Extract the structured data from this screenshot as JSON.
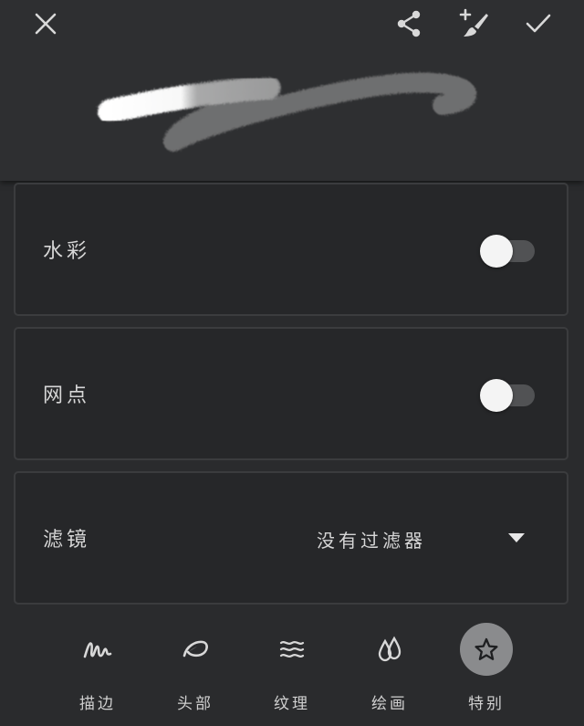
{
  "header": {
    "close_icon": "close-icon",
    "share_icon": "share-icon",
    "add_brush_icon": "add-brush-icon",
    "confirm_icon": "check-icon"
  },
  "settings": {
    "watercolor": {
      "label": "水彩",
      "enabled": false
    },
    "halftone": {
      "label": "网点",
      "enabled": false
    },
    "filter": {
      "label": "滤镜",
      "value": "没有过滤器"
    }
  },
  "tabs": [
    {
      "label": "描边",
      "icon": "stroke-icon",
      "active": false
    },
    {
      "label": "头部",
      "icon": "brush-head-icon",
      "active": false
    },
    {
      "label": "纹理",
      "icon": "texture-icon",
      "active": false
    },
    {
      "label": "绘画",
      "icon": "paint-drops-icon",
      "active": false
    },
    {
      "label": "特别",
      "icon": "star-icon",
      "active": true
    }
  ],
  "colors": {
    "background": "#2a2b2d",
    "panel_border": "#3b3c3e",
    "toggle_track": "#515254",
    "toggle_knob": "#f4f4f4",
    "active_tab": "#8a8b8d"
  }
}
